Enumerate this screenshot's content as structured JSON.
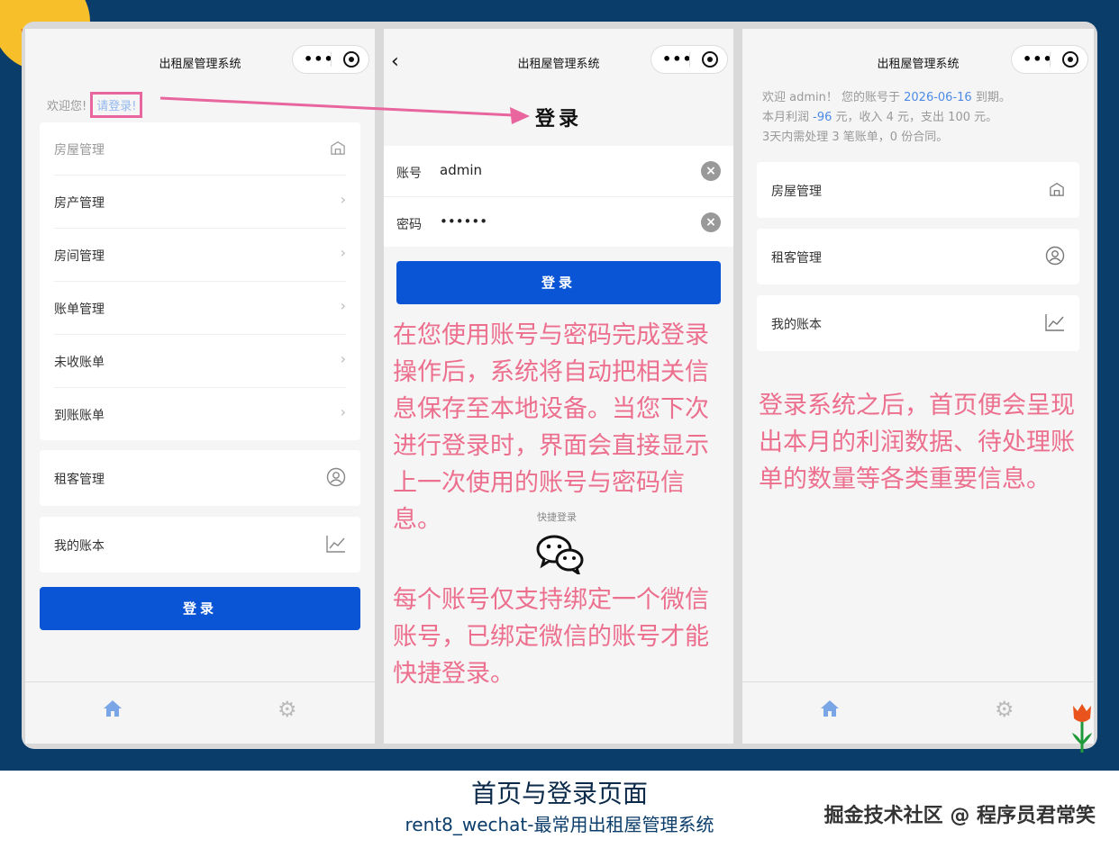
{
  "screen_home": {
    "nav_title": "出租屋管理系统",
    "welcome_text": "欢迎您!",
    "login_link": "请登录!",
    "section_house": "房屋管理",
    "items": [
      "房产管理",
      "房间管理",
      "账单管理",
      "未收账单",
      "到账账单"
    ],
    "tenant": "租客管理",
    "ledger": "我的账本",
    "login_button": "登录"
  },
  "screen_login": {
    "nav_title": "出租屋管理系统",
    "title": "登录",
    "account_label": "账号",
    "account_value": "admin",
    "password_label": "密码",
    "password_value": "••••••",
    "login_button": "登录",
    "quick_login": "快捷登录",
    "annotation_1": "在您使用账号与密码完成登录操作后，系统将自动把相关信息保存至本地设备。当您下次进行登录时，界面会直接显示上一次使用的账号与密码信息。",
    "annotation_2": "每个账号仅支持绑定一个微信账号，已绑定微信的账号才能快捷登录。"
  },
  "screen_dashboard": {
    "nav_title": "出租屋管理系统",
    "line1_prefix": "欢迎 admin！ 您的账号于 ",
    "line1_date": "2026-06-16",
    "line1_suffix": " 到期。",
    "line2_prefix": "本月利润 ",
    "line2_profit": "-96",
    "line2_suffix": " 元，收入 4 元，支出 100 元。",
    "line3": "3天内需处理 3 笔账单，0 份合同。",
    "items": [
      "房屋管理",
      "租客管理",
      "我的账本"
    ],
    "annotation": "登录系统之后，首页便会呈现出本月的利润数据、待处理账单的数量等各类重要信息。"
  },
  "caption": {
    "title": "首页与登录页面",
    "subtitle": "rent8_wechat-最常用出租屋管理系统",
    "credit": "掘金技术社区 @ 程序员君常笑"
  },
  "colors": {
    "accent_blue": "#0a55d6",
    "annotation_pink": "#ec6f8e",
    "frame_navy": "#0b3d6b"
  }
}
